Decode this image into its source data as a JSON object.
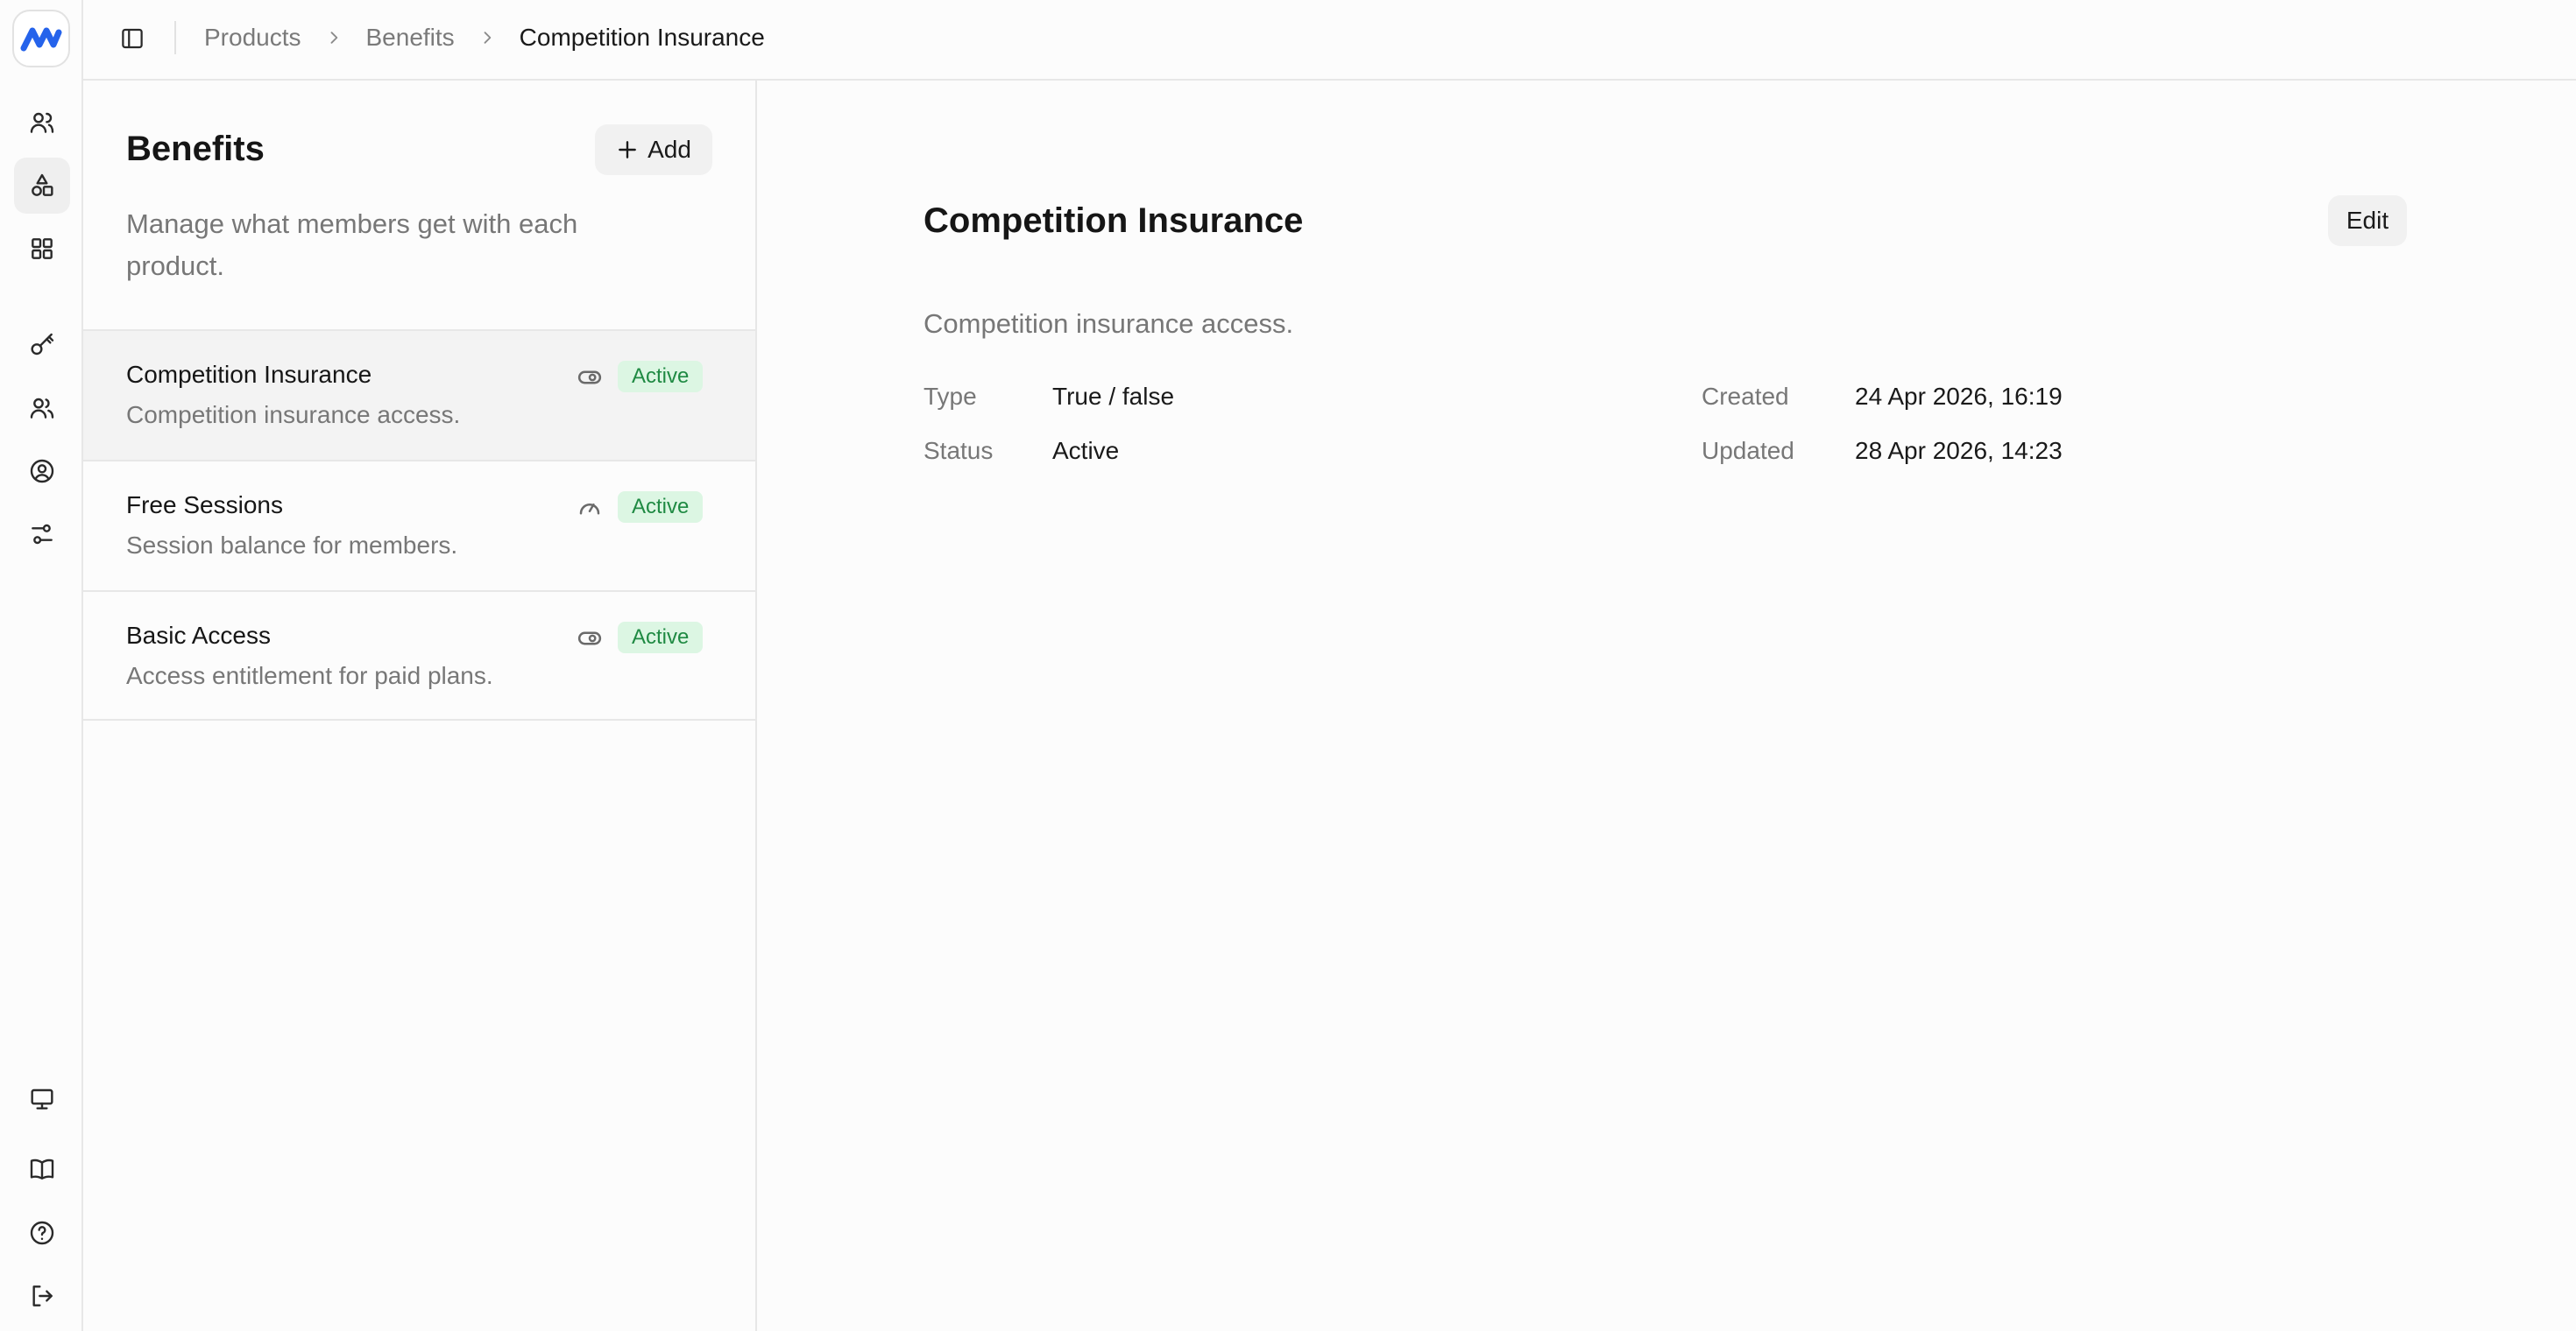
{
  "breadcrumb": [
    "Products",
    "Benefits",
    "Competition Insurance"
  ],
  "rail": {
    "top_icons": [
      "users-icon",
      "shapes-icon",
      "grid-icon",
      "key-icon",
      "members-icon",
      "user-circle-icon",
      "settings-sliders-icon"
    ],
    "active": "shapes-icon",
    "bottom_icons": [
      "monitor-icon",
      "book-icon",
      "help-icon",
      "logout-icon"
    ]
  },
  "benefits_panel": {
    "title": "Benefits",
    "add_label": "Add",
    "description": "Manage what members get with each product.",
    "items": [
      {
        "name": "Competition Insurance",
        "description": "Competition insurance access.",
        "type_icon": "toggle-icon",
        "status": "Active",
        "selected": true
      },
      {
        "name": "Free Sessions",
        "description": "Session balance for members.",
        "type_icon": "gauge-icon",
        "status": "Active",
        "selected": false
      },
      {
        "name": "Basic Access",
        "description": "Access entitlement for paid plans.",
        "type_icon": "toggle-icon",
        "status": "Active",
        "selected": false
      }
    ]
  },
  "detail": {
    "title": "Competition Insurance",
    "edit_label": "Edit",
    "description": "Competition insurance access.",
    "type_label": "Type",
    "type_value": "True / false",
    "status_label": "Status",
    "status_value": "Active",
    "created_label": "Created",
    "created_value": "24 Apr 2026, 16:19",
    "updated_label": "Updated",
    "updated_value": "28 Apr 2026, 14:23"
  },
  "colors": {
    "accent": "#2563eb",
    "badge_bg": "#dcf6e3",
    "badge_text": "#1f8a43"
  }
}
